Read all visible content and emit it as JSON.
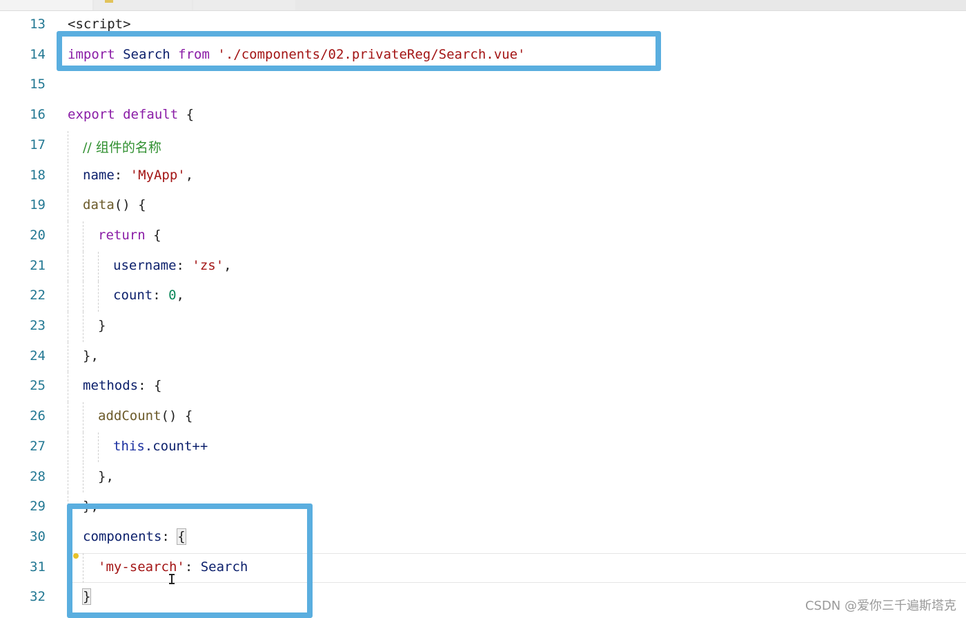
{
  "editor": {
    "lines": [
      {
        "num": "13",
        "tokens": [
          {
            "t": "<script>",
            "c": "tk-tag"
          }
        ]
      },
      {
        "num": "14",
        "tokens": [
          {
            "t": "import",
            "c": "tk-ctl"
          },
          {
            "t": " Search ",
            "c": "tk-prop"
          },
          {
            "t": "from",
            "c": "tk-ctl"
          },
          {
            "t": " ",
            "c": "tk-plain"
          },
          {
            "t": "'./components/02.privateReg/Search.vue'",
            "c": "tk-str"
          }
        ]
      },
      {
        "num": "15",
        "tokens": []
      },
      {
        "num": "16",
        "tokens": [
          {
            "t": "export",
            "c": "tk-ctl"
          },
          {
            "t": " ",
            "c": "tk-plain"
          },
          {
            "t": "default",
            "c": "tk-ctl"
          },
          {
            "t": " {",
            "c": "tk-plain"
          }
        ]
      },
      {
        "num": "17",
        "tokens": [
          {
            "t": "// 组件的名称",
            "c": "tk-cmt"
          }
        ]
      },
      {
        "num": "18",
        "tokens": [
          {
            "t": "name",
            "c": "tk-prop"
          },
          {
            "t": ": ",
            "c": "tk-plain"
          },
          {
            "t": "'MyApp'",
            "c": "tk-str"
          },
          {
            "t": ",",
            "c": "tk-plain"
          }
        ]
      },
      {
        "num": "19",
        "tokens": [
          {
            "t": "data",
            "c": "tk-fn"
          },
          {
            "t": "() {",
            "c": "tk-plain"
          }
        ]
      },
      {
        "num": "20",
        "tokens": [
          {
            "t": "return",
            "c": "tk-ctl"
          },
          {
            "t": " {",
            "c": "tk-plain"
          }
        ]
      },
      {
        "num": "21",
        "tokens": [
          {
            "t": "username",
            "c": "tk-prop"
          },
          {
            "t": ": ",
            "c": "tk-plain"
          },
          {
            "t": "'zs'",
            "c": "tk-str"
          },
          {
            "t": ",",
            "c": "tk-plain"
          }
        ]
      },
      {
        "num": "22",
        "tokens": [
          {
            "t": "count",
            "c": "tk-prop"
          },
          {
            "t": ": ",
            "c": "tk-plain"
          },
          {
            "t": "0",
            "c": "tk-num"
          },
          {
            "t": ",",
            "c": "tk-plain"
          }
        ]
      },
      {
        "num": "23",
        "tokens": [
          {
            "t": "}",
            "c": "tk-plain"
          }
        ]
      },
      {
        "num": "24",
        "tokens": [
          {
            "t": "},",
            "c": "tk-plain"
          }
        ]
      },
      {
        "num": "25",
        "tokens": [
          {
            "t": "methods",
            "c": "tk-prop"
          },
          {
            "t": ": {",
            "c": "tk-plain"
          }
        ]
      },
      {
        "num": "26",
        "tokens": [
          {
            "t": "addCount",
            "c": "tk-fn"
          },
          {
            "t": "() {",
            "c": "tk-plain"
          }
        ]
      },
      {
        "num": "27",
        "tokens": [
          {
            "t": "this",
            "c": "tk-this"
          },
          {
            "t": ".count++",
            "c": "tk-prop"
          }
        ]
      },
      {
        "num": "28",
        "tokens": [
          {
            "t": "},",
            "c": "tk-plain"
          }
        ]
      },
      {
        "num": "29",
        "tokens": [
          {
            "t": "},",
            "c": "tk-plain"
          }
        ]
      },
      {
        "num": "30",
        "tokens": [
          {
            "t": "components",
            "c": "tk-prop"
          },
          {
            "t": ": ",
            "c": "tk-plain"
          },
          {
            "t": "{",
            "c": "tk-plain bracket-match"
          }
        ]
      },
      {
        "num": "31",
        "tokens": [
          {
            "t": "'my-search'",
            "c": "tk-str"
          },
          {
            "t": ": ",
            "c": "tk-plain"
          },
          {
            "t": "Search",
            "c": "tk-prop"
          }
        ]
      },
      {
        "num": "32",
        "tokens": [
          {
            "t": "}",
            "c": "tk-plain bracket-match"
          }
        ]
      }
    ]
  },
  "watermark": "CSDN @爱你三千遍斯塔克",
  "colors": {
    "highlight_box": "#5aaedf",
    "line_number": "#237893",
    "string": "#a31515",
    "keyword": "#9b1ea8",
    "comment": "#2f8f2f"
  },
  "icons": {
    "lightbulb": "lightbulb-icon",
    "cursor": "text-cursor-icon"
  }
}
